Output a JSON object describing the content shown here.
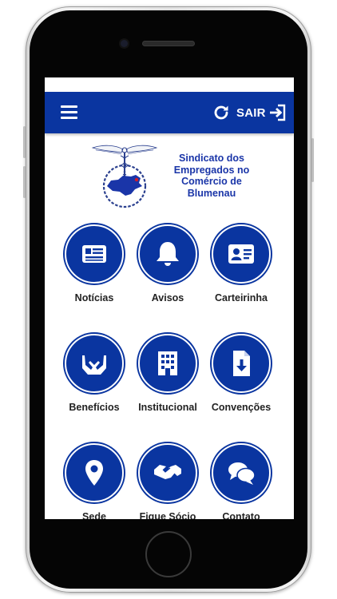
{
  "header": {
    "logout_label": "SAIR"
  },
  "logo": {
    "lines": [
      "Sindicato dos",
      "Empregados no",
      "Comércio de",
      "Blumenau"
    ]
  },
  "menu": {
    "items": [
      {
        "label": "Notícias",
        "icon": "newspaper-icon"
      },
      {
        "label": "Avisos",
        "icon": "bell-icon"
      },
      {
        "label": "Carteirinha",
        "icon": "id-card-icon"
      },
      {
        "label": "Benefícios",
        "icon": "helping-hands-icon"
      },
      {
        "label": "Institucional",
        "icon": "building-icon"
      },
      {
        "label": "Convenções",
        "icon": "file-download-icon"
      },
      {
        "label": "Sede",
        "icon": "map-marker-icon"
      },
      {
        "label": "Fique Sócio",
        "icon": "handshake-icon"
      },
      {
        "label": "Contato",
        "icon": "chat-bubbles-icon"
      }
    ]
  },
  "colors": {
    "primary": "#0a35a0",
    "logo_text": "#1a35a8",
    "label_text": "#222222"
  }
}
